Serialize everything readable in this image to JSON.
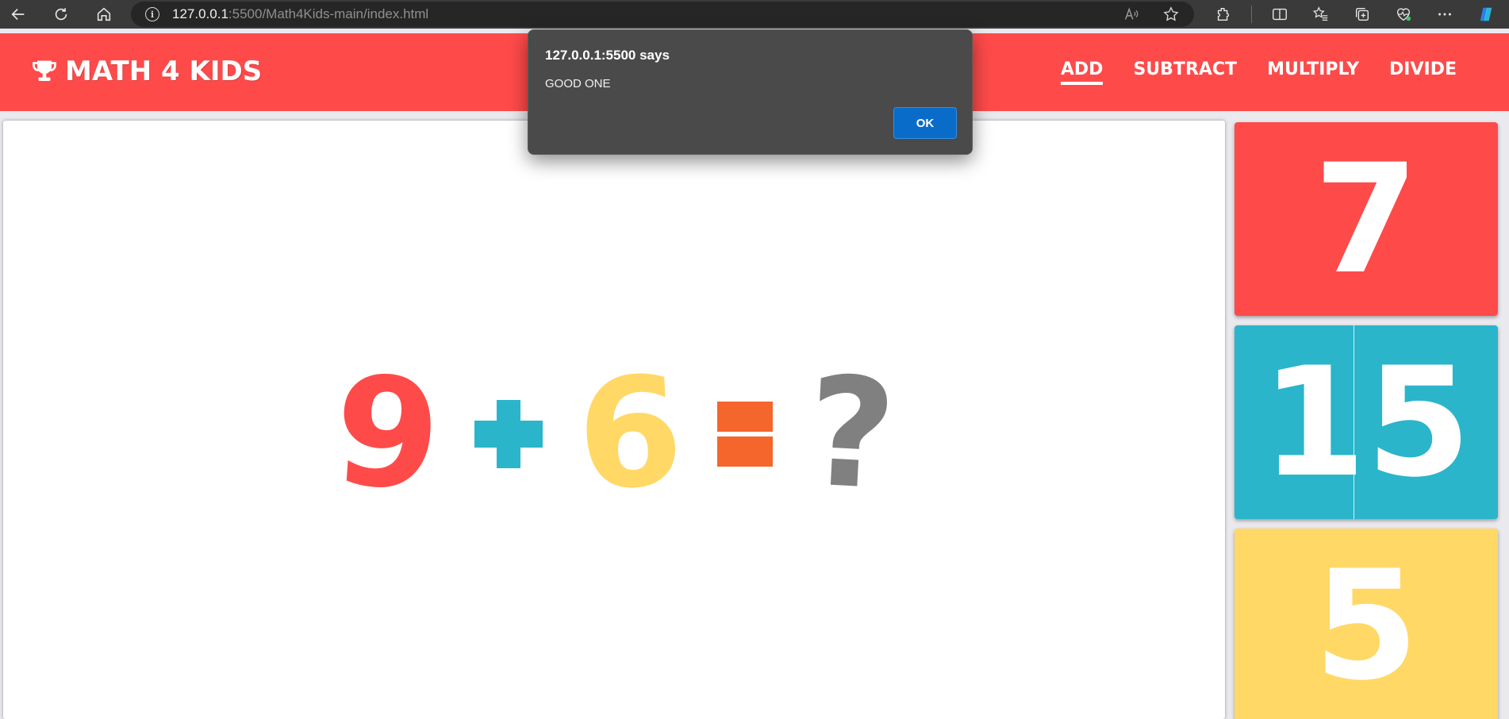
{
  "browser": {
    "url_host": "127.0.0.1",
    "url_rest": ":5500/Math4Kids-main/index.html",
    "icons": [
      "back-icon",
      "refresh-icon",
      "home-icon",
      "info-icon",
      "read-aloud-icon",
      "favorite-star-icon",
      "extensions-icon",
      "split-screen-icon",
      "favorites-icon",
      "collections-icon",
      "browser-health-icon",
      "more-icon",
      "copilot-icon"
    ]
  },
  "header": {
    "brand": "MATH 4 KIDS",
    "brand_icon": "trophy-icon",
    "nav": {
      "add": "ADD",
      "subtract": "SUBTRACT",
      "multiply": "MULTIPLY",
      "divide": "DIVIDE"
    },
    "active_nav": "ADD"
  },
  "question": {
    "a": "9",
    "b": "6",
    "unknown": "?",
    "operator": "plus",
    "colors": {
      "a": "#ff4a4a",
      "operator": "#2ab5cb",
      "b": "#ffd866",
      "equals": "#f4662b",
      "unknown": "#808080"
    }
  },
  "answers": {
    "option1": "7",
    "option2": "15",
    "option3": "5",
    "colors": [
      "#ff4a4a",
      "#2ab5cb",
      "#ffd866"
    ]
  },
  "alert": {
    "title": "127.0.0.1:5500 says",
    "message": "GOOD ONE",
    "ok_label": "OK"
  }
}
